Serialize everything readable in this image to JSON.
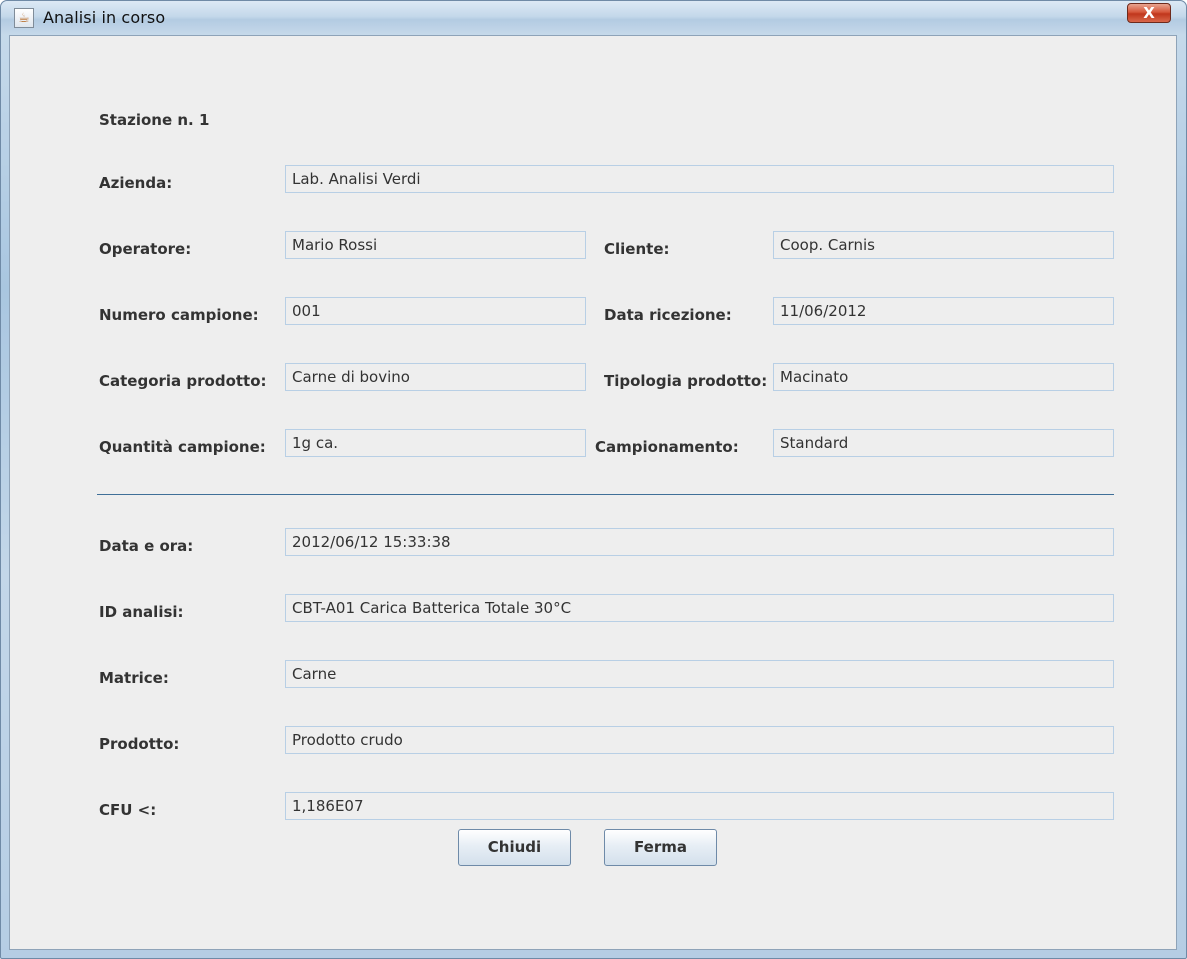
{
  "window": {
    "title": "Analisi in corso",
    "close_label": "X"
  },
  "form": {
    "station": "Stazione n. 1",
    "azienda_label": "Azienda:",
    "azienda_value": "Lab. Analisi Verdi",
    "operatore_label": "Operatore:",
    "operatore_value": "Mario Rossi",
    "cliente_label": "Cliente:",
    "cliente_value": "Coop. Carnis",
    "numero_label": "Numero campione:",
    "numero_value": "001",
    "data_ricezione_label": "Data ricezione:",
    "data_ricezione_value": "11/06/2012",
    "categoria_label": "Categoria prodotto:",
    "categoria_value": "Carne di bovino",
    "tipologia_label": "Tipologia prodotto:",
    "tipologia_value": "Macinato",
    "quantita_label": "Quantità campione:",
    "quantita_value": "1g ca.",
    "campionamento_label": "Campionamento:",
    "campionamento_value": "Standard",
    "data_ora_label": "Data e ora:",
    "data_ora_value": "2012/06/12 15:33:38",
    "id_analisi_label": "ID analisi:",
    "id_analisi_value": "CBT-A01 Carica Batterica Totale 30°C",
    "matrice_label": "Matrice:",
    "matrice_value": "Carne",
    "prodotto_label": "Prodotto:",
    "prodotto_value": "Prodotto crudo",
    "cfu_label": "CFU <:",
    "cfu_value": "1,186E07"
  },
  "buttons": {
    "chiudi": "Chiudi",
    "ferma": "Ferma"
  }
}
